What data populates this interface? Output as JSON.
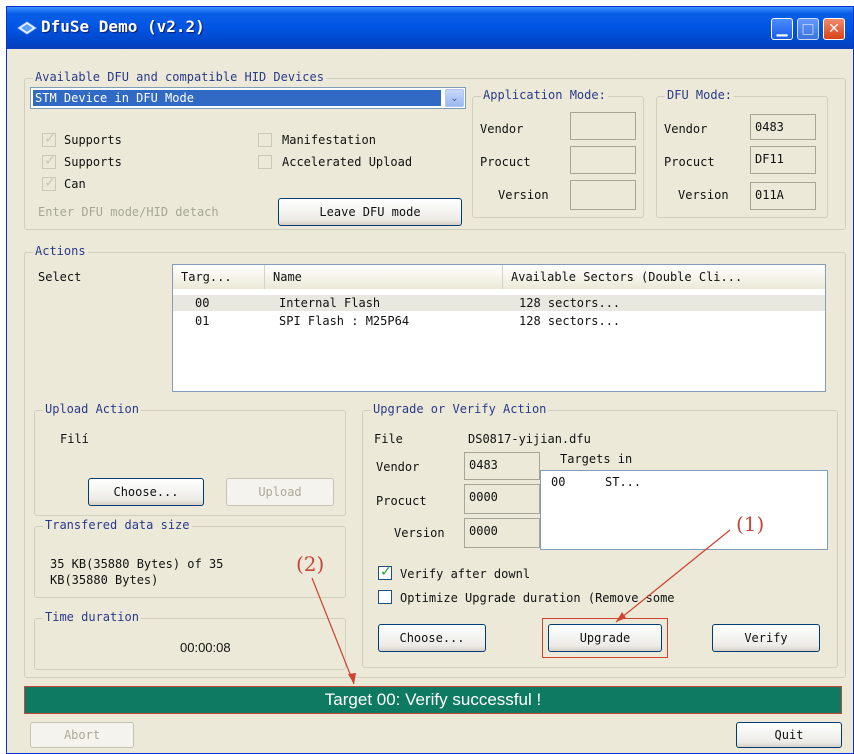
{
  "window": {
    "title": "DfuSe Demo (v2.2)"
  },
  "devices": {
    "group_label": "Available DFU and compatible HID Devices",
    "selected_device": "STM Device in DFU Mode",
    "checkboxes": [
      {
        "label": "Supports",
        "checked": true
      },
      {
        "label": "Supports",
        "checked": true
      },
      {
        "label": "Can",
        "checked": true
      },
      {
        "label": "Manifestation",
        "checked": false
      },
      {
        "label": "Accelerated Upload",
        "checked": false
      }
    ],
    "enter_dfu_label": "Enter DFU mode/HID detach",
    "leave_dfu_label": "Leave DFU mode"
  },
  "app_mode": {
    "label": "Application Mode:",
    "vendor_label": "Vendor",
    "vendor": "",
    "product_label": "Procuct",
    "product": "",
    "version_label": "Version",
    "version": ""
  },
  "dfu_mode": {
    "label": "DFU Mode:",
    "vendor_label": "Vendor",
    "vendor": "0483",
    "product_label": "Procuct",
    "product": "DF11",
    "version_label": "Version",
    "version": "011A"
  },
  "actions": {
    "label": "Actions",
    "select_label": "Select",
    "columns": [
      "Targ...",
      "Name",
      "Available Sectors (Double Cli..."
    ],
    "rows": [
      {
        "target": "00",
        "name": "Internal Flash",
        "sectors": "128 sectors..."
      },
      {
        "target": "01",
        "name": "SPI Flash : M25P64",
        "sectors": "128 sectors..."
      }
    ]
  },
  "upload": {
    "label": "Upload Action",
    "file_label": "Filí",
    "choose_label": "Choose...",
    "upload_label": "Upload"
  },
  "transfer": {
    "label": "Transfered data size",
    "value": "35 KB(35880 Bytes) of 35\nKB(35880 Bytes)"
  },
  "time": {
    "label": "Time duration",
    "value": "00:00:08"
  },
  "upgrade": {
    "label": "Upgrade or Verify Action",
    "file_label": "File",
    "file_value": "DS0817-yijian.dfu",
    "vendor_label": "Vendor",
    "vendor": "0483",
    "product_label": "Procuct",
    "product": "0000",
    "version_label": "Version",
    "version": "0000",
    "targets_in_label": "Targets in",
    "targets_in_rows": [
      {
        "id": "00",
        "name": "ST..."
      }
    ],
    "verify_after_label": "Verify after downl",
    "verify_after_checked": true,
    "optimize_label": "Optimize Upgrade duration (Remove some",
    "optimize_checked": false,
    "choose_label": "Choose...",
    "upgrade_label": "Upgrade",
    "verify_label": "Verify"
  },
  "annotations": {
    "one": "(1)",
    "two": "(2)",
    "color": "#c8453a"
  },
  "status": {
    "text": "Target 00: Verify successful !",
    "color": "#0f7a62"
  },
  "footer": {
    "abort_label": "Abort",
    "quit_label": "Quit"
  }
}
